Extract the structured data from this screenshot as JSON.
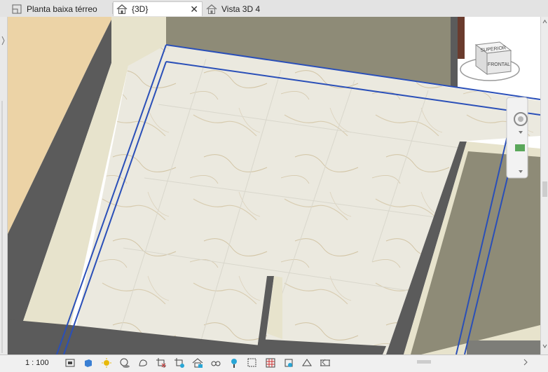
{
  "tabs": [
    {
      "label": "Planta baixa térreo",
      "icon": "floor-plan-icon",
      "active": false
    },
    {
      "label": "{3D}",
      "icon": "house-3d-icon",
      "active": true
    },
    {
      "label": "Vista 3D 4",
      "icon": "house-3d-icon",
      "active": false
    }
  ],
  "viewcube": {
    "top_label": "SUPERIOR",
    "front_label": "FRONTAL"
  },
  "status": {
    "scale": "1 : 100"
  },
  "view_controls": [
    "detail-level-icon",
    "visual-style-icon",
    "sun-path-icon",
    "shadows-icon",
    "rendering-icon",
    "crop-view-icon",
    "show-crop-region-icon",
    "unlock-3d-view-icon",
    "temporary-hide-icon",
    "reveal-hidden-icon",
    "analytical-model-icon",
    "highlight-displacement-icon",
    "reveal-constraints-icon",
    "worksharing-display-icon",
    "edit-crop-icon"
  ],
  "colors": {
    "selection": "#2a4fb8",
    "wall": "#595959",
    "wall_face": "#e6e2cb",
    "floor": "#e9e7dc",
    "wood": "#ecd3a6"
  }
}
